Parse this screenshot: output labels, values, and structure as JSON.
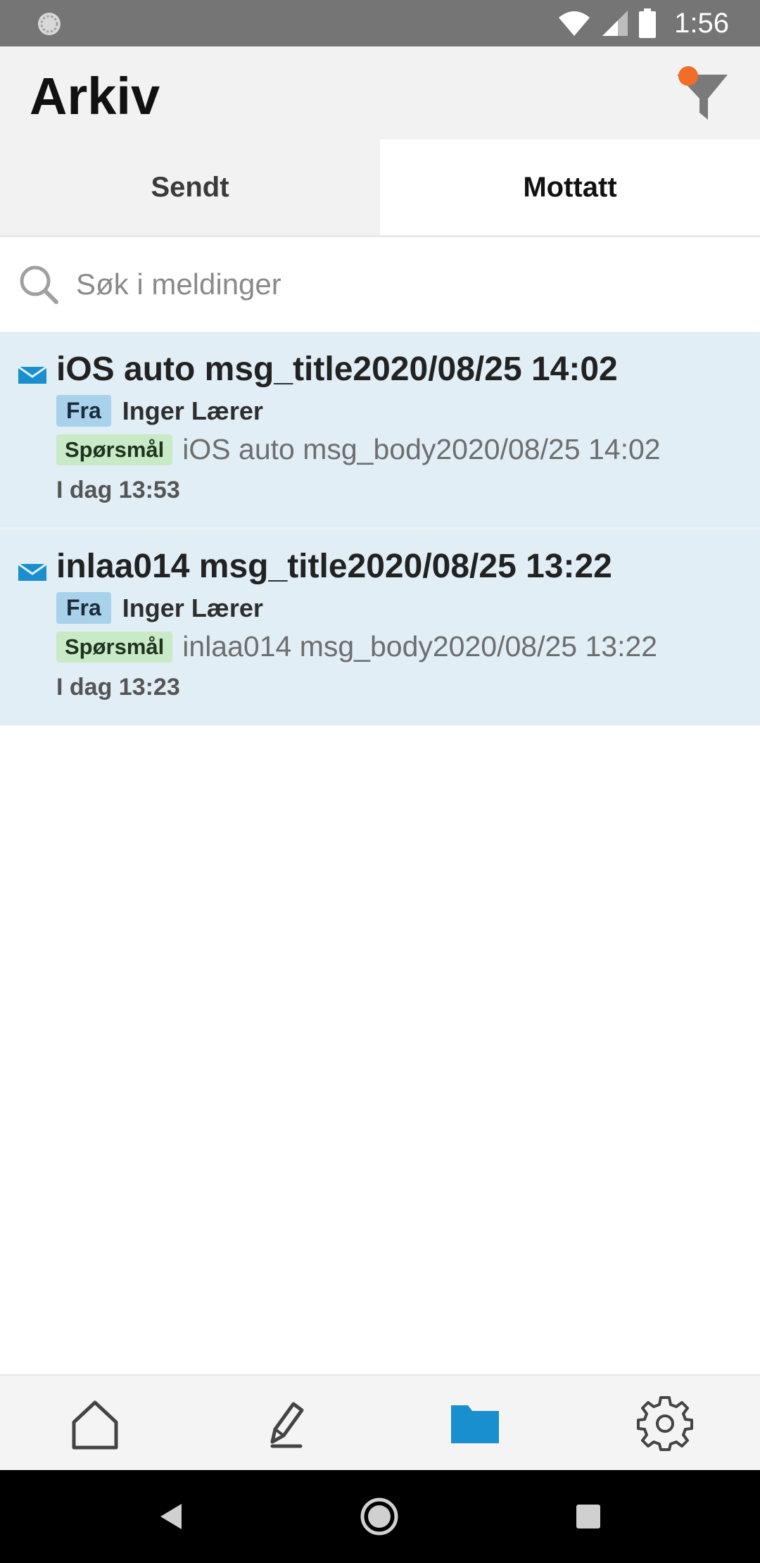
{
  "status_bar": {
    "time": "1:56",
    "icons": [
      "sync-icon",
      "wifi-icon",
      "signal-icon",
      "battery-icon"
    ]
  },
  "header": {
    "title": "Arkiv",
    "filter_icon": "filter-icon",
    "filter_dot_color": "#f26c2a"
  },
  "tabs": [
    {
      "label": "Sendt",
      "active": false
    },
    {
      "label": "Mottatt",
      "active": true
    }
  ],
  "search": {
    "placeholder": "Søk i meldinger",
    "value": ""
  },
  "messages": [
    {
      "title": "iOS auto msg_title2020/08/25 14:02",
      "from_label": "Fra",
      "sender": "Inger Lærer",
      "type": "Spørsmål",
      "body": "iOS auto msg_body2020/08/25 14:02",
      "time": "I dag 13:53",
      "unread": true
    },
    {
      "title": "inlaa014 msg_title2020/08/25 13:22",
      "from_label": "Fra",
      "sender": "Inger Lærer",
      "type": "Spørsmål",
      "body": "inlaa014 msg_body2020/08/25 13:22",
      "time": "I dag 13:23",
      "unread": true
    }
  ],
  "bottom_nav": [
    {
      "icon": "home-icon",
      "active": false
    },
    {
      "icon": "compose-icon",
      "active": false
    },
    {
      "icon": "folder-icon",
      "active": true
    },
    {
      "icon": "settings-icon",
      "active": false
    }
  ],
  "colors": {
    "accent": "#1a8fd0",
    "unread_background": "#e1eef6",
    "badge_from": "#a8d1ec",
    "badge_type": "#c9eac6"
  }
}
